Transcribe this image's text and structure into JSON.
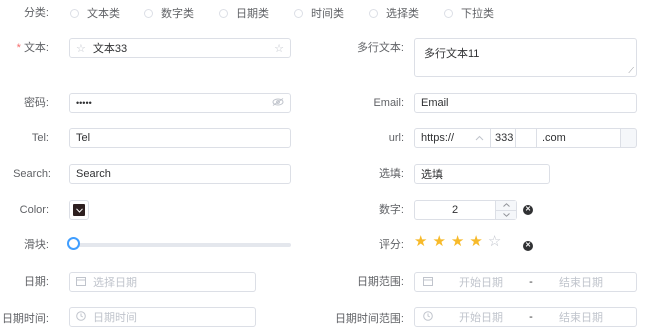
{
  "category": {
    "label": "分类:",
    "options": [
      "文本类",
      "数字类",
      "日期类",
      "时间类",
      "选择类",
      "下拉类"
    ]
  },
  "text": {
    "label": "文本:",
    "required_mark": "*",
    "value": "文本33"
  },
  "textarea": {
    "label": "多行文本:",
    "value": "多行文本11"
  },
  "password": {
    "label": "密码:",
    "value": "•••••"
  },
  "email": {
    "label": "Email:",
    "value": "Email"
  },
  "tel": {
    "label": "Tel:",
    "value": "Tel"
  },
  "url": {
    "label": "url:",
    "protocol": "https://",
    "host": "333",
    "suffix": ".com"
  },
  "search": {
    "label": "Search:",
    "value": "Search"
  },
  "select_fill": {
    "label": "选填:",
    "value": "选填"
  },
  "color": {
    "label": "Color:",
    "value": "#2d1f1f"
  },
  "number": {
    "label": "数字:",
    "value": "2"
  },
  "slider": {
    "label": "滑块:",
    "value": 0
  },
  "rating": {
    "label": "评分:",
    "value": 4,
    "max": 5
  },
  "date": {
    "label": "日期:",
    "placeholder": "选择日期"
  },
  "date_range": {
    "label": "日期范围:",
    "start": "开始日期",
    "sep": "-",
    "end": "结束日期"
  },
  "datetime": {
    "label": "日期时间:",
    "placeholder": "日期时间"
  },
  "datetime_range": {
    "label": "日期时间范围:",
    "start": "开始日期",
    "sep": "-",
    "end": "结束日期"
  }
}
